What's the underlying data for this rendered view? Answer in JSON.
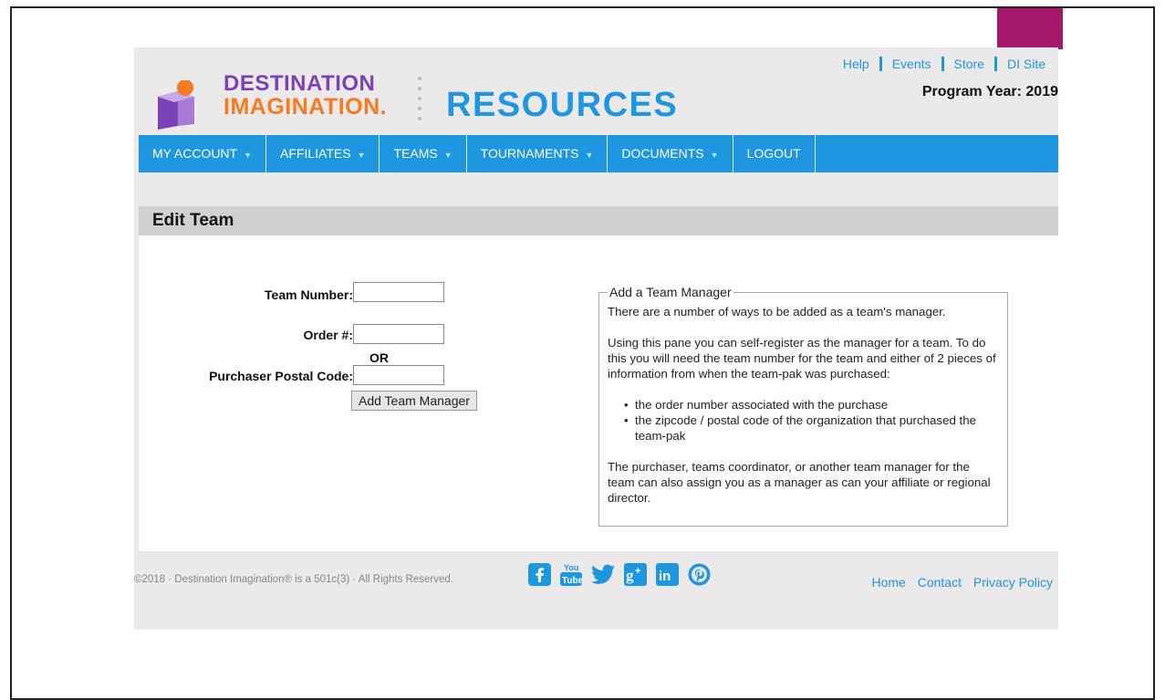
{
  "brand": {
    "logo_line1": "DESTINATION",
    "logo_line2": "IMAGINATION.",
    "section_title": "RESOURCES",
    "accent_color": "#1e97e0",
    "slide_accent_color": "#a5176b"
  },
  "top_links": [
    "Help",
    "Events",
    "Store",
    "DI Site"
  ],
  "program_year": "Program Year: 2019",
  "nav": [
    {
      "label": "MY ACCOUNT",
      "has_dropdown": true
    },
    {
      "label": "AFFILIATES",
      "has_dropdown": true
    },
    {
      "label": "TEAMS",
      "has_dropdown": true
    },
    {
      "label": "TOURNAMENTS",
      "has_dropdown": true
    },
    {
      "label": "DOCUMENTS",
      "has_dropdown": true
    },
    {
      "label": "LOGOUT",
      "has_dropdown": false
    }
  ],
  "page": {
    "title": "Edit Team",
    "form": {
      "team_number_label": "Team Number:",
      "team_number_value": "",
      "order_label": "Order #:",
      "order_value": "",
      "or_label": "OR",
      "postal_label": "Purchaser Postal Code:",
      "postal_value": "",
      "submit_label": "Add Team Manager"
    },
    "help": {
      "legend": "Add a Team Manager",
      "intro": "There are a number of ways to be added as a team's manager.",
      "instructions": "Using this pane you can self-register as the manager for a team. To do this you will need the team number for the team and either of 2 pieces of information from when the team-pak was purchased:",
      "bullets": [
        "the order number associated with the purchase",
        "the zipcode / postal code of the organization that purchased the team-pak"
      ],
      "closing": "The purchaser, teams coordinator, or another team manager for the team can also assign you as a manager as can your affiliate or regional director."
    }
  },
  "footer": {
    "copyright": "©2018 · Destination Imagination® is a 501c(3) · All Rights Reserved.",
    "social": [
      "facebook-icon",
      "youtube-icon",
      "twitter-icon",
      "google-plus-icon",
      "linkedin-icon",
      "pinterest-icon"
    ],
    "links": [
      "Home",
      "Contact",
      "Privacy Policy"
    ]
  }
}
